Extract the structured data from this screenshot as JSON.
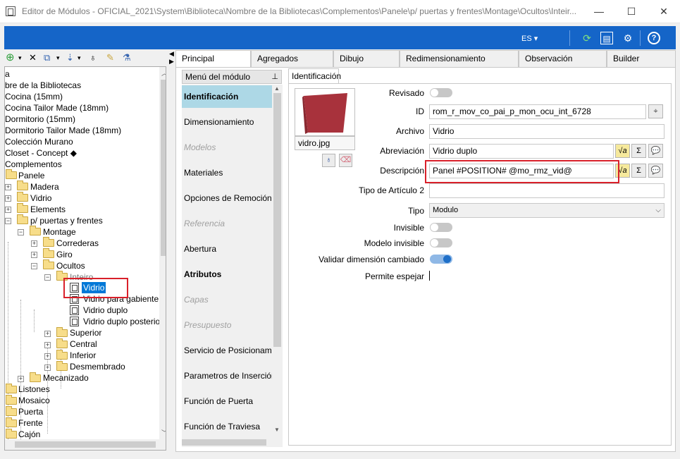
{
  "window": {
    "title": "Editor de Módulos - OFICIAL_2021\\System\\Biblioteca\\Nombre de la Bibliotecas\\Complementos\\Panele\\p/ puertas y frentes\\Montage\\Ocultos\\Inteir...",
    "minimize_glyph": "—",
    "maximize_glyph": "☐",
    "close_glyph": "✕"
  },
  "header": {
    "language": "ES ▾",
    "icons": [
      "refresh-icon",
      "layout-icon",
      "settings-icon",
      "help-icon"
    ],
    "refresh_glyph": "⟳",
    "layout_glyph": "▤",
    "settings_glyph": "⚙",
    "help_glyph": "?"
  },
  "left_toolbar": {
    "new_glyph": "⊕",
    "dropdown_glyph": "▾",
    "delete_glyph": "✕",
    "copy_glyph": "⧉",
    "move_glyph": "⇣",
    "find_glyph": "♁",
    "edit_glyph": "✎",
    "sim_glyph": "⚗"
  },
  "tree": {
    "items": [
      {
        "label": "a"
      },
      {
        "label": "bre de la Bibliotecas"
      },
      {
        "label": "Cocina (15mm)"
      },
      {
        "label": "Cocina Tailor Made (18mm)"
      },
      {
        "label": "Dormitorio (15mm)"
      },
      {
        "label": "Dormitorio Tailor Made (18mm)"
      },
      {
        "label": "Colección Murano"
      },
      {
        "label": "Closet - Concept ◆"
      },
      {
        "label": "Complementos"
      },
      {
        "label": "Panele"
      },
      {
        "label": "Madera"
      },
      {
        "label": "Vidrio"
      },
      {
        "label": "Elements"
      },
      {
        "label": "p/ puertas y frentes"
      },
      {
        "label": "Montage"
      },
      {
        "label": "Correderas"
      },
      {
        "label": "Giro"
      },
      {
        "label": "Ocultos"
      },
      {
        "label": "Inteiro"
      },
      {
        "label": "Vidrio"
      },
      {
        "label": "Vidrio para gabiente"
      },
      {
        "label": "Vidrio duplo"
      },
      {
        "label": "Vidrio duplo posterio"
      },
      {
        "label": "Superior"
      },
      {
        "label": "Central"
      },
      {
        "label": "Inferior"
      },
      {
        "label": "Desmembrado"
      },
      {
        "label": "Mecanizado"
      },
      {
        "label": "Listones"
      },
      {
        "label": "Mosaico"
      },
      {
        "label": "Puerta"
      },
      {
        "label": "Frente"
      },
      {
        "label": "Cajón"
      }
    ]
  },
  "tabs": [
    {
      "label": "Principal"
    },
    {
      "label": "Agregados"
    },
    {
      "label": "Dibujo"
    },
    {
      "label": "Redimensionamiento"
    },
    {
      "label": "Observación"
    },
    {
      "label": "Builder"
    }
  ],
  "module_menu": {
    "header": "Menú del módulo",
    "pin_glyph": "⊥",
    "items": [
      {
        "label": "Identificación"
      },
      {
        "label": "Dimensionamiento"
      },
      {
        "label": "Modelos"
      },
      {
        "label": "Materiales"
      },
      {
        "label": "Opciones de Remoción"
      },
      {
        "label": "Referencia"
      },
      {
        "label": "Abertura"
      },
      {
        "label": "Atributos"
      },
      {
        "label": "Capas"
      },
      {
        "label": "Presupuesto"
      },
      {
        "label": "Servicio de Posicionamiento"
      },
      {
        "label": "Parametros de Inserción"
      },
      {
        "label": "Función de Puerta"
      },
      {
        "label": "Función de Traviesa"
      }
    ]
  },
  "identification": {
    "subtab": "Identificación",
    "image_name": "vidro.jpg",
    "image_color": "#a8323c",
    "search_glyph": "♁",
    "erase_glyph": "⌫",
    "fields": {
      "revisado_label": "Revisado",
      "id_label": "ID",
      "id_value": "rom_r_mov_co_pai_p_mon_ocu_int_6728",
      "archivo_label": "Archivo",
      "archivo_value": "Vidrio",
      "abreviacion_label": "Abreviación",
      "abreviacion_value": "Vidrio duplo",
      "descripcion_label": "Descripción",
      "descripcion_value": "Panel #POSITION# @mo_rmz_vid@",
      "tipo_articulo_label": "Tipo de Artículo 2",
      "tipo_articulo_value": "",
      "tipo_label": "Tipo",
      "tipo_value": "Modulo",
      "invisible_label": "Invisible",
      "modelo_invisible_label": "Modelo invisible",
      "validar_label": "Validar dimensión cambiado",
      "permite_label": "Permite espejar"
    },
    "formula_glyph": "√a",
    "sigma_glyph": "Σ",
    "comment_glyph": "💬",
    "pick_glyph": "⌖"
  }
}
